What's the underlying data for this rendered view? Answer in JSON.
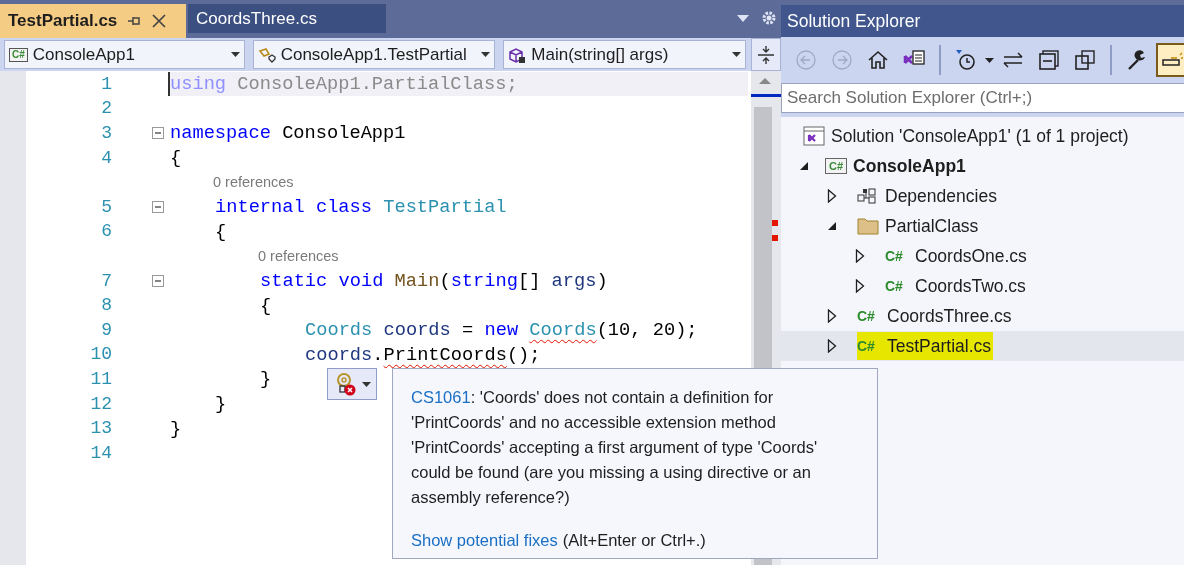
{
  "editor_tabs": [
    {
      "label": "TestPartial.cs",
      "selected": true
    },
    {
      "label": "CoordsThree.cs",
      "selected": false
    }
  ],
  "navigation_bar": {
    "project_badge": "C#",
    "project": "ConsoleApp1",
    "type": "ConsoleApp1.TestPartial",
    "member": "Main(string[] args)"
  },
  "code_lines": [
    {
      "number": "1",
      "fold": false,
      "current": true,
      "tokens": [
        {
          "text": "using ",
          "kind": "faded-keyword"
        },
        {
          "text": "ConsoleApp1.PartialClass;",
          "kind": "faded"
        }
      ]
    },
    {
      "number": "2",
      "fold": false,
      "current": false
    },
    {
      "number": "3",
      "fold": true,
      "current": false,
      "tokens": [
        {
          "text": "namespace ",
          "kind": "keyword"
        },
        {
          "text": "ConsoleApp1",
          "kind": "plain"
        }
      ]
    },
    {
      "number": "4",
      "fold": false,
      "current": false,
      "tokens": [
        {
          "text": "{",
          "kind": "plain"
        }
      ],
      "children": [
        {
          "number": "5",
          "codelens": "0 references",
          "fold": true,
          "current": false,
          "tokens": [
            {
              "text": "internal class ",
              "kind": "keyword"
            },
            {
              "text": "TestPartial",
              "kind": "type"
            }
          ]
        },
        {
          "number": "6",
          "fold": false,
          "current": false,
          "tokens": [
            {
              "text": "{",
              "kind": "plain"
            }
          ],
          "children": [
            {
              "number": "7",
              "codelens": "0 references",
              "fold": true,
              "current": false,
              "tokens": [
                {
                  "text": "static void ",
                  "kind": "keyword"
                },
                {
                  "text": "Main",
                  "kind": "method"
                },
                {
                  "text": "(",
                  "kind": "plain"
                },
                {
                  "text": "string",
                  "kind": "keyword"
                },
                {
                  "text": "[] ",
                  "kind": "plain"
                },
                {
                  "text": "args",
                  "kind": "ident"
                },
                {
                  "text": ")",
                  "kind": "plain"
                }
              ]
            },
            {
              "number": "8",
              "fold": false,
              "current": false,
              "tokens": [
                {
                  "text": "{",
                  "kind": "plain"
                }
              ],
              "children": [
                {
                  "number": "9",
                  "fold": false,
                  "current": false,
                  "tokens": [
                    {
                      "text": "Coords ",
                      "kind": "type",
                      "error": false
                    },
                    {
                      "text": "coords",
                      "kind": "ident",
                      "error": false
                    },
                    {
                      "text": " = ",
                      "kind": "plain",
                      "error": false
                    },
                    {
                      "text": "new ",
                      "kind": "keyword",
                      "error": false
                    },
                    {
                      "text": "Coords",
                      "kind": "type",
                      "error": true
                    },
                    {
                      "text": "(10, 20);",
                      "kind": "plain",
                      "error": false
                    }
                  ]
                },
                {
                  "number": "10",
                  "fold": false,
                  "current": false,
                  "tokens": [
                    {
                      "text": "coords",
                      "kind": "ident",
                      "error": false
                    },
                    {
                      "text": ".",
                      "kind": "plain",
                      "error": false
                    },
                    {
                      "text": "PrintCoords",
                      "kind": "plain",
                      "error": true
                    },
                    {
                      "text": "();",
                      "kind": "plain",
                      "error": false
                    }
                  ]
                }
              ]
            },
            {
              "number": "11",
              "fold": false,
              "current": false,
              "tokens": [
                {
                  "text": "}",
                  "kind": "plain"
                }
              ]
            }
          ]
        },
        {
          "number": "12",
          "fold": false,
          "current": false,
          "tokens": [
            {
              "text": "}",
              "kind": "plain"
            }
          ]
        }
      ]
    },
    {
      "number": "13",
      "fold": false,
      "current": false,
      "tokens": [
        {
          "text": "}",
          "kind": "plain"
        }
      ]
    },
    {
      "number": "14",
      "fold": false,
      "current": false
    }
  ],
  "quick_info": {
    "error_code": "CS1061",
    "message": ": 'Coords' does not contain a definition for 'PrintCoords' and no accessible extension method 'PrintCoords' accepting a first argument of type 'Coords' could be found (are you missing a using directive or an assembly reference?)",
    "fix_link": "Show potential fixes",
    "fix_shortcut": "(Alt+Enter or Ctrl+.)"
  },
  "solution_explorer": {
    "title": "Solution Explorer",
    "toolbar": [
      {
        "kind": "back",
        "disabled": true,
        "on": false
      },
      {
        "kind": "forward",
        "disabled": true,
        "on": false
      },
      {
        "kind": "home",
        "disabled": false,
        "on": false
      },
      {
        "kind": "switch-view",
        "disabled": false,
        "on": false
      },
      {
        "kind": "pending-filter",
        "disabled": false,
        "on": false
      },
      {
        "kind": "sync",
        "disabled": false,
        "on": false
      },
      {
        "kind": "collapse",
        "disabled": false,
        "on": false
      },
      {
        "kind": "copies",
        "disabled": false,
        "on": false
      },
      {
        "kind": "properties",
        "disabled": false,
        "on": false
      },
      {
        "kind": "preview",
        "disabled": false,
        "on": true
      }
    ],
    "search": {
      "placeholder": "Search Solution Explorer (Ctrl+;)"
    },
    "tree": {
      "label": "Solution 'ConsoleApp1' (1 of 1 project)",
      "kind": "solution",
      "selected": false,
      "children": [
        {
          "label": "ConsoleApp1",
          "kind": "project",
          "badge": "C#",
          "expanded": true,
          "selected": false,
          "children": [
            {
              "label": "Dependencies",
              "kind": "dependencies",
              "expanded": false,
              "selected": false
            },
            {
              "label": "PartialClass",
              "kind": "folder",
              "expanded": true,
              "selected": false,
              "children": [
                {
                  "label": "CoordsOne.cs",
                  "kind": "file",
                  "badge": "C#",
                  "expanded": false,
                  "selected": false
                },
                {
                  "label": "CoordsTwo.cs",
                  "kind": "file",
                  "badge": "C#",
                  "expanded": false,
                  "selected": false
                }
              ]
            },
            {
              "label": "CoordsThree.cs",
              "kind": "file",
              "badge": "C#",
              "expanded": false,
              "selected": false
            },
            {
              "label": "TestPartial.cs",
              "kind": "file",
              "badge": "C#",
              "expanded": false,
              "selected": true
            }
          ]
        }
      ]
    }
  }
}
